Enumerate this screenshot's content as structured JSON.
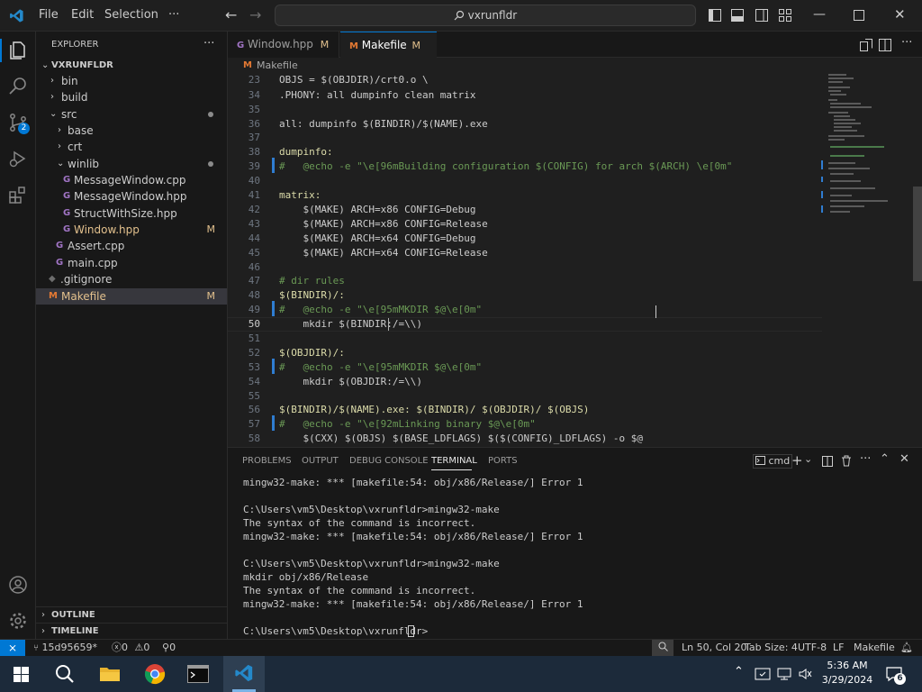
{
  "titlebar": {
    "menus": [
      "File",
      "Edit",
      "Selection",
      "···"
    ],
    "search_text": "vxrunfldr"
  },
  "explorer": {
    "title": "EXPLORER",
    "more": "···",
    "root": "VXRUNFLDR",
    "items": [
      {
        "label": "bin",
        "badge": ""
      },
      {
        "label": "build",
        "badge": ""
      },
      {
        "label": "src",
        "badge": ""
      },
      {
        "label": "base",
        "badge": ""
      },
      {
        "label": "crt",
        "badge": ""
      },
      {
        "label": "winlib",
        "badge": ""
      },
      {
        "label": "MessageWindow.cpp",
        "badge": ""
      },
      {
        "label": "MessageWindow.hpp",
        "badge": ""
      },
      {
        "label": "StructWithSize.hpp",
        "badge": ""
      },
      {
        "label": "Window.hpp",
        "badge": "M"
      },
      {
        "label": "Assert.cpp",
        "badge": ""
      },
      {
        "label": "main.cpp",
        "badge": ""
      },
      {
        "label": ".gitignore",
        "badge": ""
      },
      {
        "label": "Makefile",
        "badge": "M"
      }
    ],
    "outline": "OUTLINE",
    "timeline": "TIMELINE"
  },
  "tabs": [
    {
      "label": "Window.hpp",
      "badge": "M"
    },
    {
      "label": "Makefile",
      "badge": "M"
    }
  ],
  "breadcrumb": "Makefile",
  "scm_badge": "2",
  "editor": {
    "lines": [
      {
        "n": "23",
        "t": "OBJS = $(OBJDIR)/crt0.o \\"
      },
      {
        "n": "34",
        "t": ".PHONY: all dumpinfo clean matrix"
      },
      {
        "n": "35",
        "t": ""
      },
      {
        "n": "36",
        "t": "all: dumpinfo $(BINDIR)/$(NAME).exe"
      },
      {
        "n": "37",
        "t": ""
      },
      {
        "n": "38",
        "t": "dumpinfo:"
      },
      {
        "n": "39",
        "t": "#   @echo -e \"\\e[96mBuilding configuration $(CONFIG) for arch $(ARCH) \\e[0m\""
      },
      {
        "n": "40",
        "t": ""
      },
      {
        "n": "41",
        "t": "matrix:"
      },
      {
        "n": "42",
        "t": "    $(MAKE) ARCH=x86 CONFIG=Debug"
      },
      {
        "n": "43",
        "t": "    $(MAKE) ARCH=x86 CONFIG=Release"
      },
      {
        "n": "44",
        "t": "    $(MAKE) ARCH=x64 CONFIG=Debug"
      },
      {
        "n": "45",
        "t": "    $(MAKE) ARCH=x64 CONFIG=Release"
      },
      {
        "n": "46",
        "t": ""
      },
      {
        "n": "47",
        "t": "# dir rules"
      },
      {
        "n": "48",
        "t": "$(BINDIR)/:"
      },
      {
        "n": "49",
        "t": "#   @echo -e \"\\e[95mMKDIR $@\\e[0m\""
      },
      {
        "n": "50",
        "t": "    mkdir $(BINDIR:/=\\\\)"
      },
      {
        "n": "51",
        "t": ""
      },
      {
        "n": "52",
        "t": "$(OBJDIR)/:"
      },
      {
        "n": "53",
        "t": "#   @echo -e \"\\e[95mMKDIR $@\\e[0m\""
      },
      {
        "n": "54",
        "t": "    mkdir $(OBJDIR:/=\\\\)"
      },
      {
        "n": "55",
        "t": ""
      },
      {
        "n": "56",
        "t": "$(BINDIR)/$(NAME).exe: $(BINDIR)/ $(OBJDIR)/ $(OBJS)"
      },
      {
        "n": "57",
        "t": "#   @echo -e \"\\e[92mLinking binary $@\\e[0m\""
      },
      {
        "n": "58",
        "t": "    $(CXX) $(OBJS) $(BASE_LDFLAGS) $($(CONFIG)_LDFLAGS) -o $@"
      }
    ]
  },
  "panel": {
    "tabs": [
      "PROBLEMS",
      "OUTPUT",
      "DEBUG CONSOLE",
      "TERMINAL",
      "PORTS"
    ],
    "active_tab": "TERMINAL",
    "shell": "cmd",
    "terminal_lines": [
      "mingw32-make: *** [makefile:54: obj/x86/Release/] Error 1",
      "",
      "C:\\Users\\vm5\\Desktop\\vxrunfldr>mingw32-make",
      "The syntax of the command is incorrect.",
      "mingw32-make: *** [makefile:54: obj/x86/Release/] Error 1",
      "",
      "C:\\Users\\vm5\\Desktop\\vxrunfldr>mingw32-make",
      "mkdir obj/x86/Release",
      "The syntax of the command is incorrect.",
      "mingw32-make: *** [makefile:54: obj/x86/Release/] Error 1",
      "",
      "C:\\Users\\vm5\\Desktop\\vxrunfldr>"
    ]
  },
  "statusbar": {
    "branch": "15d95659*",
    "errors": "0",
    "warnings": "0",
    "ports": "0",
    "position": "Ln 50, Col 20",
    "tab_size": "Tab Size: 4",
    "encoding": "UTF-8",
    "eol": "LF",
    "language": "Makefile"
  },
  "taskbar": {
    "time": "5:36 AM",
    "date": "3/29/2024",
    "notifications": "6"
  },
  "colors": {
    "accent": "#0078d4",
    "modified": "#e2c08d",
    "editor_bg": "#1f1f1f",
    "sidebar_bg": "#181818"
  }
}
